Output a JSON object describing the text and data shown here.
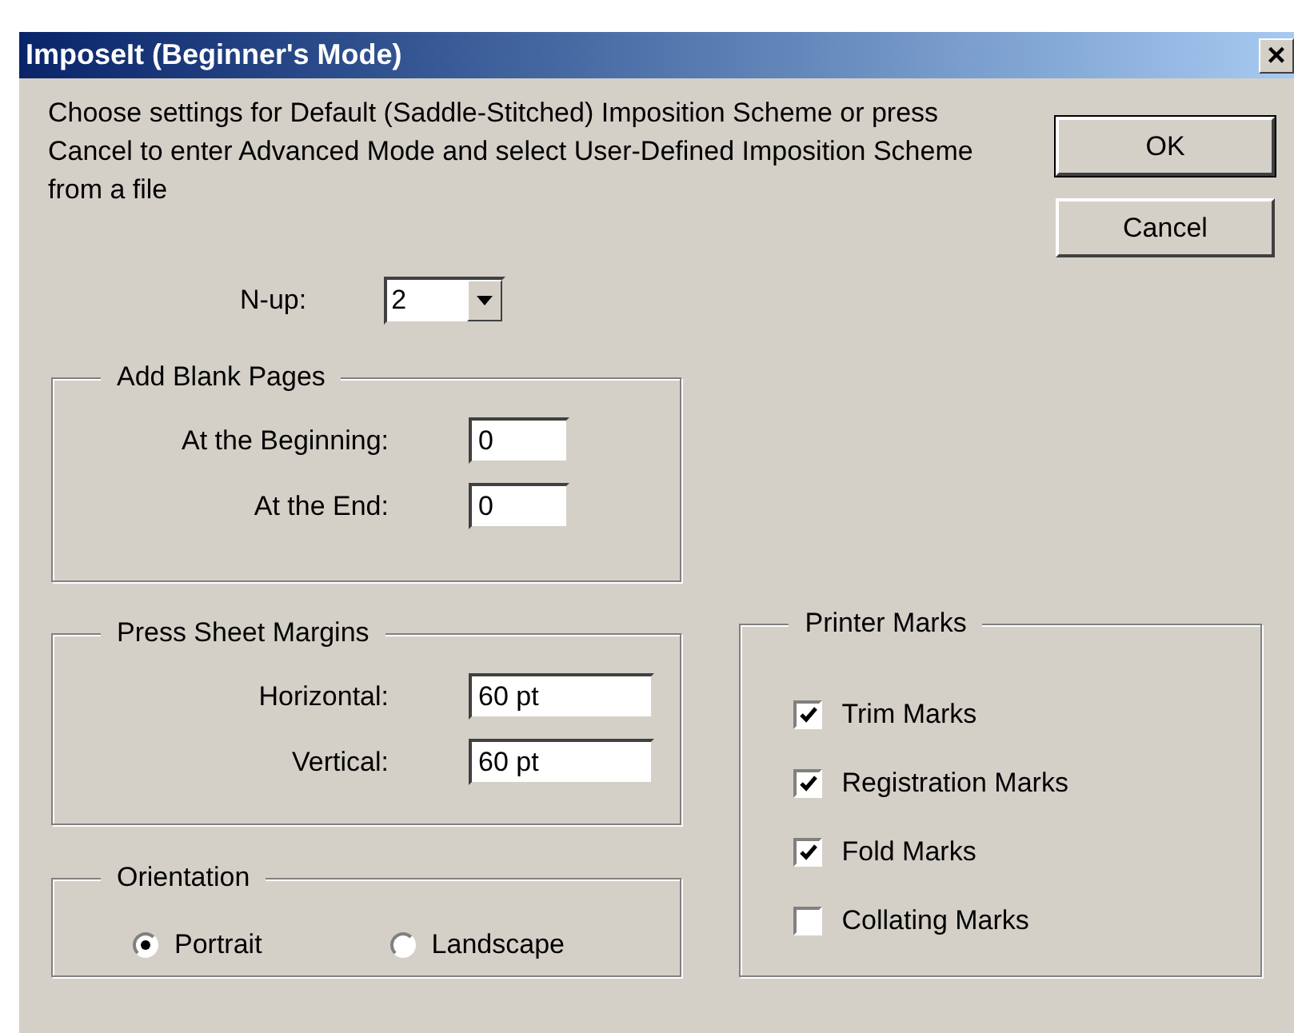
{
  "window": {
    "title": "ImposeIt (Beginner's Mode)",
    "close": "×"
  },
  "description": "Choose settings for Default (Saddle-Stitched) Imposition Scheme or press Cancel to enter Advanced Mode and select User-Defined Imposition Scheme from a file",
  "buttons": [
    {
      "label": "OK",
      "default": true
    },
    {
      "label": "Cancel",
      "default": false
    }
  ],
  "n_up": {
    "label": "N-up:",
    "value": "2"
  },
  "add_blank_pages": {
    "title": "Add Blank Pages",
    "fields": [
      {
        "label": "At the Beginning:",
        "value": "0"
      },
      {
        "label": "At the End:",
        "value": "0"
      }
    ]
  },
  "press_sheet_margins": {
    "title": "Press Sheet Margins",
    "fields": [
      {
        "label": "Horizontal:",
        "value": "60 pt"
      },
      {
        "label": "Vertical:",
        "value": "60 pt"
      }
    ]
  },
  "orientation": {
    "title": "Orientation",
    "options": [
      {
        "label": "Portrait",
        "selected": true
      },
      {
        "label": "Landscape",
        "selected": false
      }
    ]
  },
  "printer_marks": {
    "title": "Printer Marks",
    "items": [
      {
        "label": "Trim Marks",
        "checked": true
      },
      {
        "label": "Registration Marks",
        "checked": true
      },
      {
        "label": "Fold Marks",
        "checked": true
      },
      {
        "label": "Collating Marks",
        "checked": false
      }
    ]
  }
}
